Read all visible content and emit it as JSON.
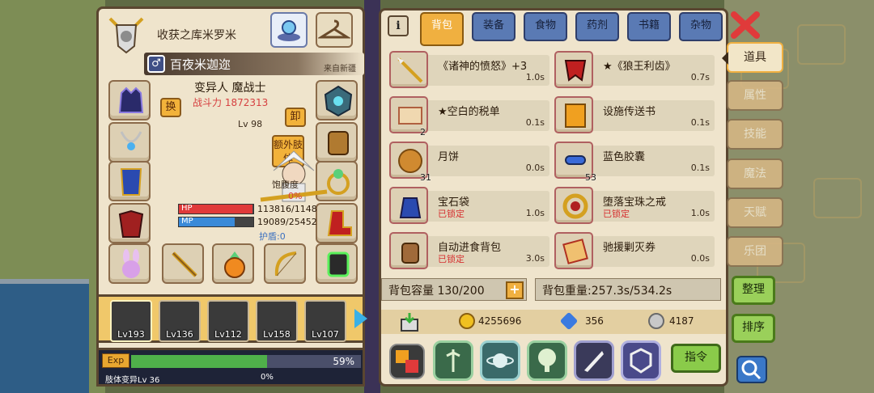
{
  "character": {
    "title": "收获之库米罗米",
    "gender_symbol": "♂",
    "name": "百夜米迦迩",
    "origin": "来自新疆",
    "race_class": "变异人 魔战士",
    "power": "战斗力 1872313",
    "swap_label": "换",
    "unequip_label": "卸",
    "extra_limb_label": "额外肢体",
    "level": "Lv 98",
    "satiety_label": "饱腹度",
    "satiety_value": "0%",
    "hp_label": "HP",
    "hp_value": "113816/1148",
    "hp_fraction": 0.99,
    "mp_label": "MP",
    "mp_value": "19089/25452",
    "mp_fraction": 0.75,
    "shield": "护盾:0"
  },
  "team": [
    {
      "level": "Lv193"
    },
    {
      "level": "Lv136"
    },
    {
      "level": "Lv112"
    },
    {
      "level": "Lv158"
    },
    {
      "level": "Lv107"
    }
  ],
  "exp": {
    "badge": "Exp",
    "percent": "59%",
    "fraction": 0.59,
    "limb_label": "肢体变异Lv 36",
    "limb_percent": "0%"
  },
  "inventory": {
    "info_label": "i",
    "tabs": [
      {
        "label": "背包",
        "active": true
      },
      {
        "label": "装备"
      },
      {
        "label": "食物"
      },
      {
        "label": "药剂"
      },
      {
        "label": "书籍"
      },
      {
        "label": "杂物"
      }
    ],
    "items": [
      {
        "name": "《诸神的愤怒》+3",
        "time": "1.0s",
        "lock": "",
        "count": ""
      },
      {
        "name": "★《狼王利齿》",
        "time": "0.7s",
        "lock": "",
        "count": ""
      },
      {
        "name": "★空白的税单",
        "time": "0.1s",
        "lock": "",
        "count": "2"
      },
      {
        "name": "设施传送书",
        "time": "0.1s",
        "lock": "",
        "count": ""
      },
      {
        "name": "月饼",
        "time": "0.0s",
        "lock": "",
        "count": "31"
      },
      {
        "name": "蓝色胶囊",
        "time": "0.1s",
        "lock": "",
        "count": "53"
      },
      {
        "name": "宝石袋",
        "time": "1.0s",
        "lock": "已锁定",
        "count": ""
      },
      {
        "name": "堕落宝珠之戒",
        "time": "1.0s",
        "lock": "已锁定",
        "count": ""
      },
      {
        "name": "自动进食背包",
        "time": "3.0s",
        "lock": "已锁定",
        "count": ""
      },
      {
        "name": "驰援剿灭券",
        "time": "0.0s",
        "lock": "",
        "count": ""
      }
    ],
    "capacity": "背包容量 130/200",
    "weight": "背包重量:257.3s/534.2s",
    "gold": "4255696",
    "diamond": "356",
    "silver": "4187",
    "command_label": "指令"
  },
  "side_tabs": [
    {
      "label": "道具",
      "active": true
    },
    {
      "label": "属性"
    },
    {
      "label": "技能"
    },
    {
      "label": "魔法"
    },
    {
      "label": "天赋"
    },
    {
      "label": "乐团"
    }
  ],
  "right_buttons": {
    "organize": "整理",
    "sort": "排序"
  },
  "colors": {
    "panel": "#efe4cc",
    "tab_blue": "#5a7ab4",
    "tab_active": "#f0b040",
    "hp": "#e03a3a",
    "mp": "#3a8ad8",
    "exp": "#4fb04a",
    "lock_red": "#d63030"
  }
}
